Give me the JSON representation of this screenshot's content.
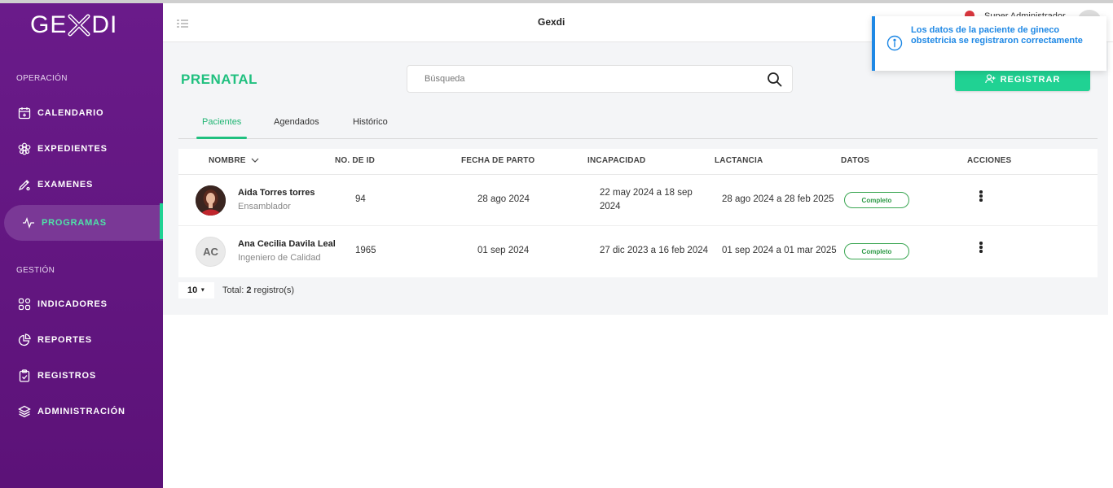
{
  "brand": {
    "logo_prefix": "GE",
    "logo_suffix": "DI"
  },
  "sidebar": {
    "sections": [
      {
        "label": "OPERACIÓN"
      },
      {
        "label": "GESTIÓN"
      }
    ],
    "items": [
      {
        "label": "CALENDARIO",
        "icon": "calendar-icon"
      },
      {
        "label": "EXPEDIENTES",
        "icon": "flower-icon"
      },
      {
        "label": "EXAMENES",
        "icon": "pen-tool-icon"
      },
      {
        "label": "PROGRAMAS",
        "icon": "activity-icon",
        "active": true
      },
      {
        "label": "INDICADORES",
        "icon": "grid-icon"
      },
      {
        "label": "REPORTES",
        "icon": "pie-chart-icon"
      },
      {
        "label": "REGISTROS",
        "icon": "clipboard-check-icon"
      },
      {
        "label": "ADMINISTRACIÓN",
        "icon": "layers-icon"
      }
    ]
  },
  "topbar": {
    "title": "Gexdi",
    "user": "Super Administrador"
  },
  "page": {
    "title": "PRENATAL",
    "search_placeholder": "Búsqueda",
    "register_label": "REGISTRAR"
  },
  "tabs": [
    {
      "label": "Pacientes",
      "active": true
    },
    {
      "label": "Agendados"
    },
    {
      "label": "Histórico"
    }
  ],
  "table": {
    "headers": [
      "NOMBRE",
      "NO. DE ID",
      "FECHA DE PARTO",
      "INCAPACIDAD",
      "LACTANCIA",
      "DATOS",
      "ACCIONES"
    ],
    "rows": [
      {
        "name": "Aida Torres torres",
        "role": "Ensamblador",
        "avatar": "photo",
        "id": "94",
        "birth_date": "28 ago 2024",
        "incapacity_line1": "22 may 2024 a 18 sep",
        "incapacity_line2": "2024",
        "lactation": "28 ago 2024 a 28 feb 2025",
        "status": "Completo"
      },
      {
        "name": "Ana Cecilia Davila Leal",
        "role": "Ingeniero de Calidad",
        "avatar": "AC",
        "id": "1965",
        "birth_date": "01 sep 2024",
        "incapacity": "27 dic 2023 a 16 feb 2024",
        "lactation": "01 sep 2024 a 01 mar 2025",
        "status": "Completo"
      }
    ]
  },
  "pager": {
    "page_size": "10",
    "total_prefix": "Total: ",
    "total_count": "2",
    "total_suffix": " registro(s)"
  },
  "toast": {
    "message": "Los datos de la paciente de gineco obstetricia se registraron correctamente",
    "color": "#1e88e5"
  },
  "colors": {
    "sidebar": "#6a1b8a",
    "accent": "#20d293",
    "title": "#20c07f"
  }
}
